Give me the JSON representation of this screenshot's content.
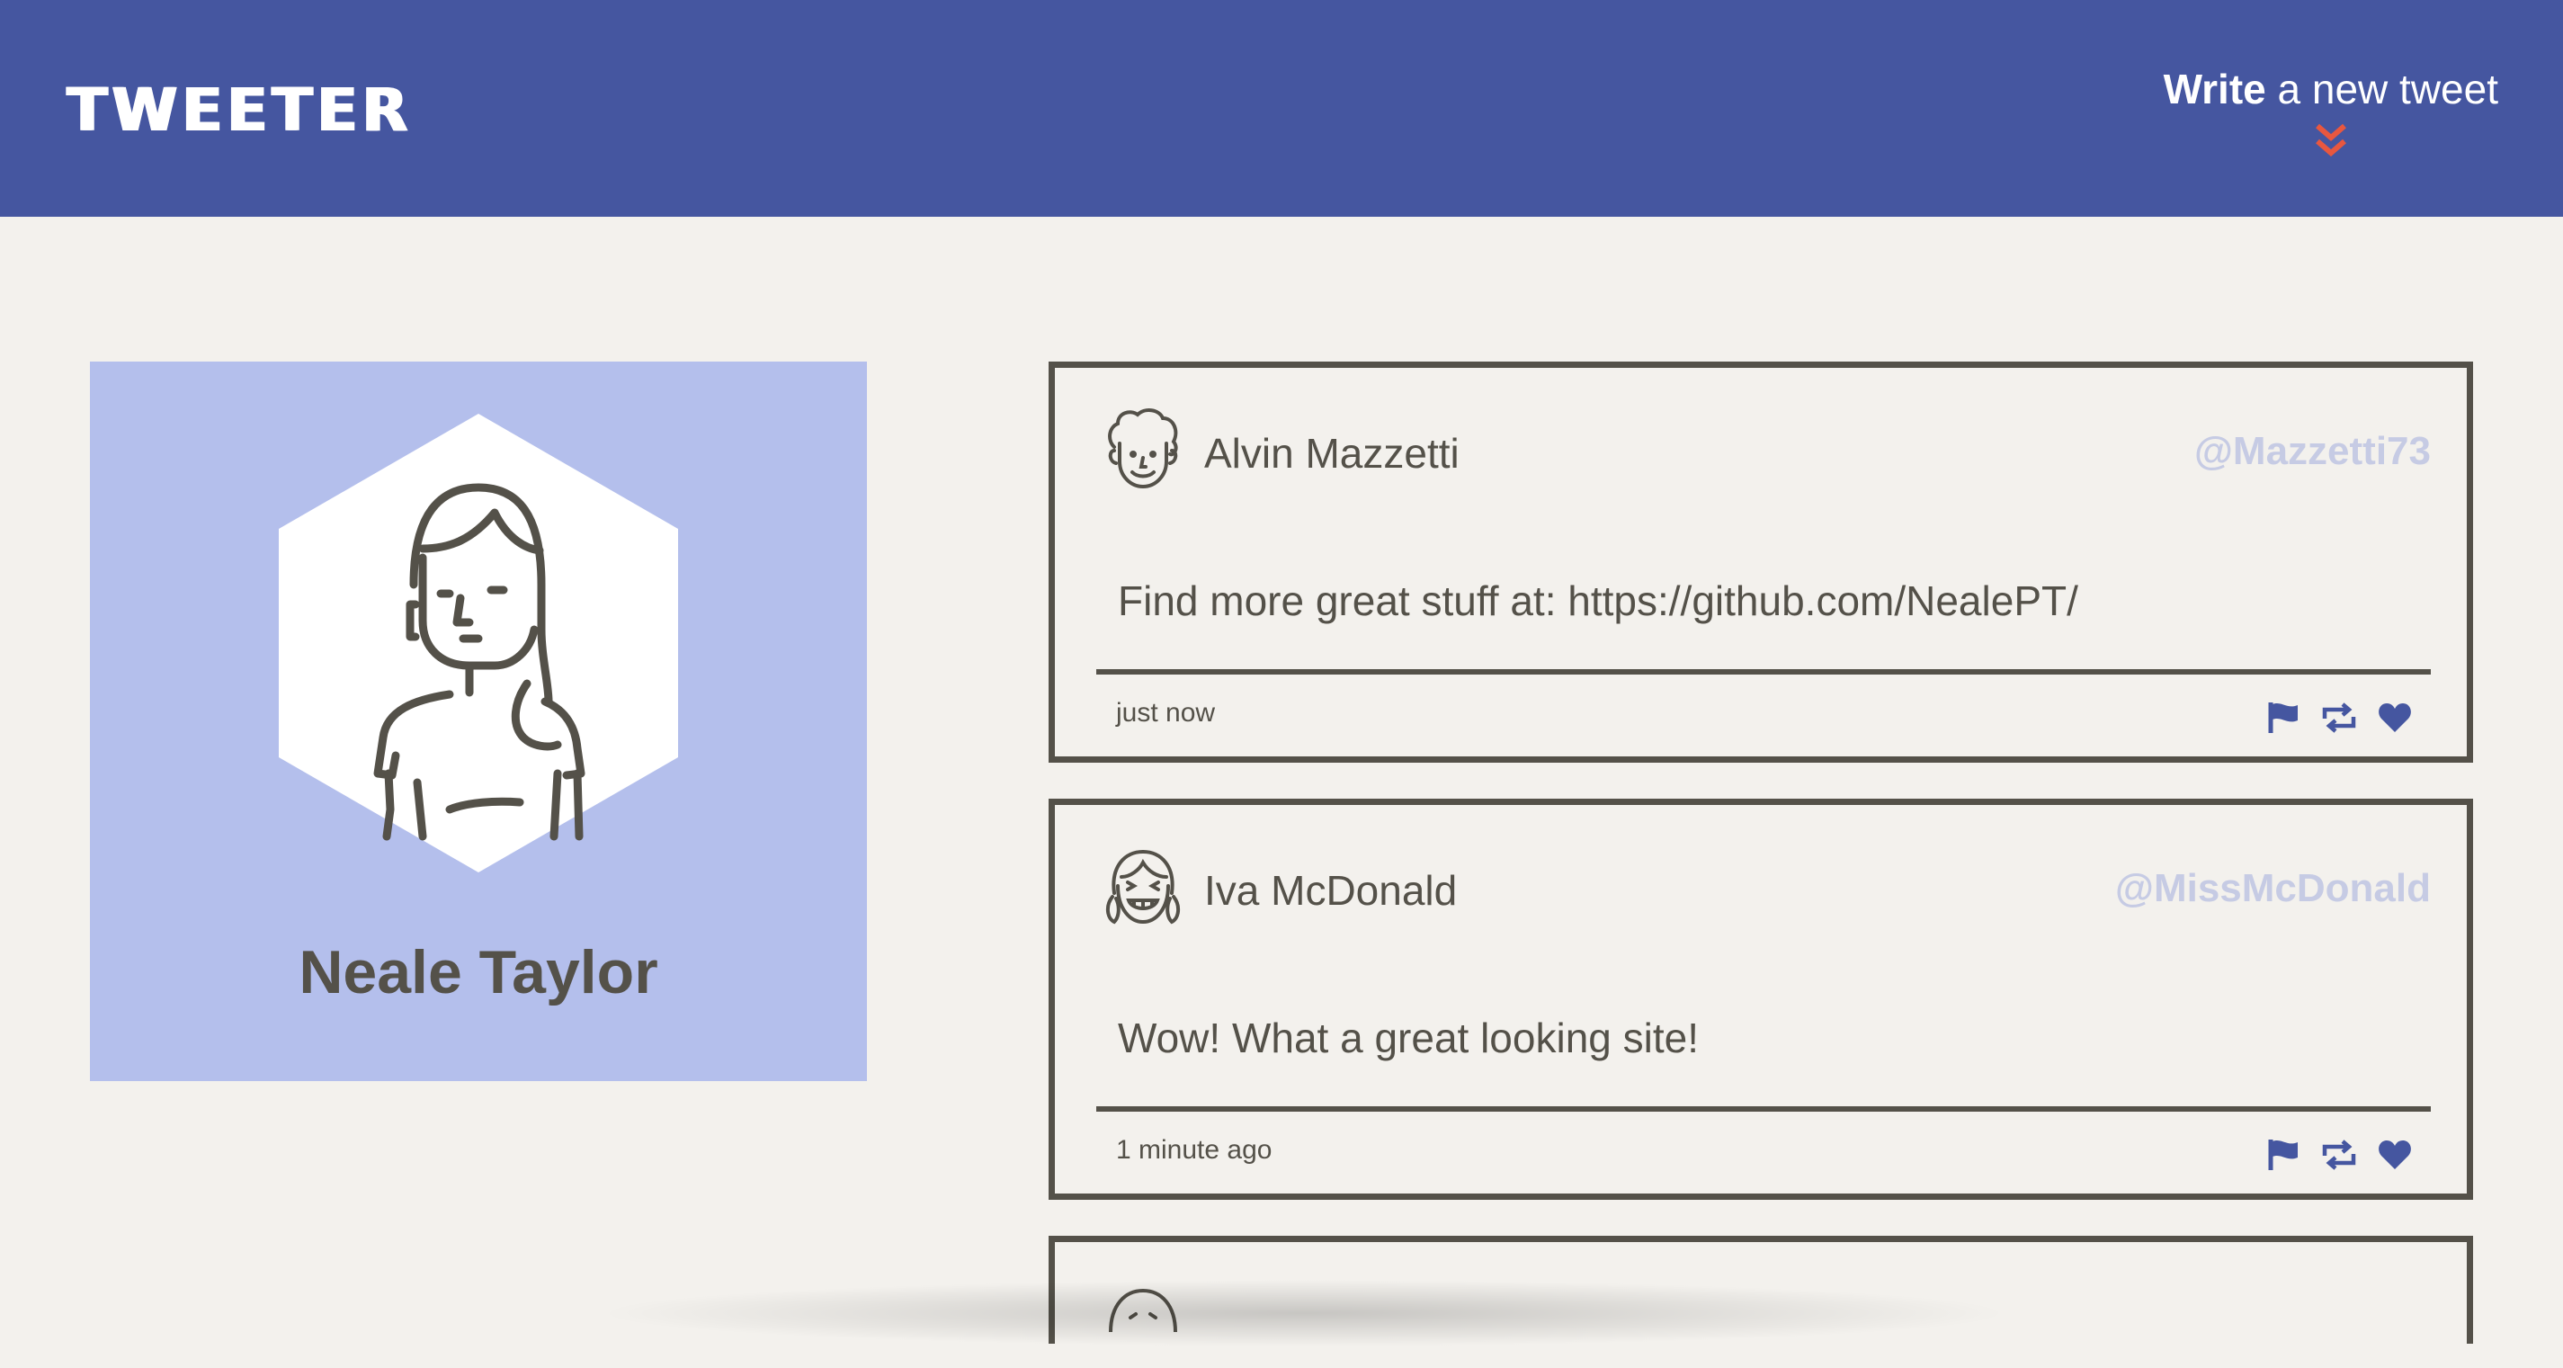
{
  "nav": {
    "logo": "TWEETER",
    "compose_strong": "Write",
    "compose_rest": " a new tweet",
    "compose_icon": "double-chevron-down-icon",
    "accent_color": "#e8573f"
  },
  "profile": {
    "name": "Neale Taylor",
    "avatar_icon": "woman-avatar-icon",
    "background_color": "#b4bfec"
  },
  "tweets": [
    {
      "author": "Alvin Mazzetti",
      "handle": "@Mazzetti73",
      "content": "Find more great stuff at: https://github.com/NealePT/",
      "time": "just now",
      "avatar_icon": "curly-hair-man-avatar-icon"
    },
    {
      "author": "Iva McDonald",
      "handle": "@MissMcDonald",
      "content": "Wow! What a great looking site!",
      "time": "1 minute ago",
      "avatar_icon": "pigtails-girl-avatar-icon"
    }
  ],
  "actions": [
    "flag-icon",
    "retweet-icon",
    "heart-icon"
  ],
  "colors": {
    "nav": "#4556a0",
    "page": "#f3f1ed",
    "text": "#545149",
    "handle": "#c6cbe4",
    "icon": "#4556a0"
  }
}
